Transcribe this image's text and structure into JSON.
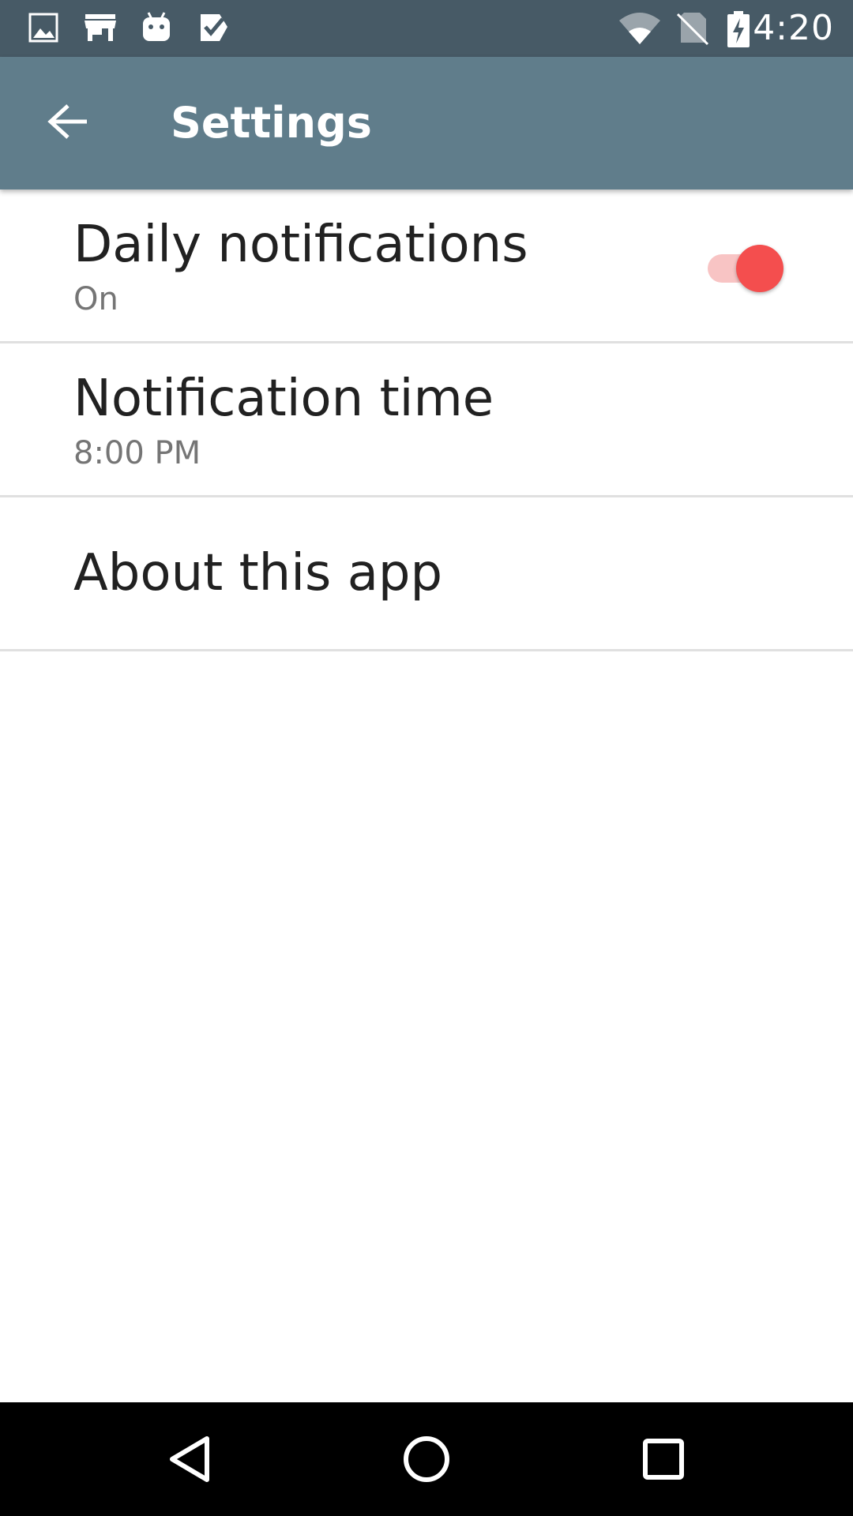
{
  "status_bar": {
    "time": "4:20",
    "left_icons": [
      "image-icon",
      "store-icon",
      "android-icon",
      "task-check-icon"
    ],
    "right_icons": [
      "wifi-icon",
      "no-sim-icon",
      "battery-charging-icon"
    ]
  },
  "app_bar": {
    "title": "Settings",
    "color": "#607d8b",
    "status_color": "#475a66"
  },
  "preferences": [
    {
      "title": "Daily notifications",
      "summary": "On",
      "switch_on": true
    },
    {
      "title": "Notification time",
      "summary": "8:00 PM"
    },
    {
      "title": "About this app"
    }
  ],
  "accent": "#f44e4e",
  "nav_bar": {
    "icons": [
      "back-icon",
      "home-icon",
      "recents-icon"
    ]
  }
}
